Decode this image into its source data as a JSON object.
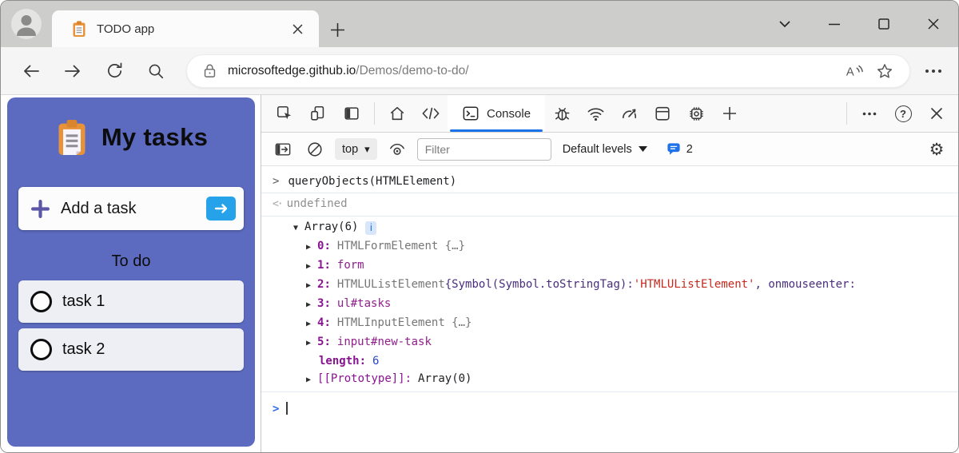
{
  "titlebar": {
    "tab_title": "TODO app"
  },
  "toolbar": {
    "url_host": "microsoftedge.github.io",
    "url_path": "/Demos/demo-to-do/"
  },
  "app": {
    "title": "My tasks",
    "add_task_label": "Add a task",
    "section_title": "To do",
    "tasks": [
      "task 1",
      "task 2"
    ]
  },
  "devtools": {
    "tabbar": {
      "console_tab_label": "Console"
    },
    "filterbar": {
      "context_label": "top",
      "filter_placeholder": "Filter",
      "levels_label": "Default levels",
      "message_count": "2"
    },
    "console": {
      "input_command": "queryObjects(HTMLElement)",
      "result_value": "undefined",
      "array": {
        "header": "Array(6)",
        "info_badge": "i",
        "items": [
          {
            "key": "0:",
            "preview": "HTMLFormElement {…}"
          },
          {
            "key": "1:",
            "node": "form"
          },
          {
            "key": "2:",
            "class_name": "HTMLUListElement ",
            "preview_dark": "{Symbol(Symbol.toStringTag): ",
            "string": "'HTMLUListElement'",
            "preview_dark_2": ", onmouseenter:"
          },
          {
            "key": "3:",
            "node": "ul#tasks"
          },
          {
            "key": "4:",
            "preview": "HTMLInputElement {…}"
          },
          {
            "key": "5:",
            "node": "input#new-task"
          }
        ],
        "length_key": "length:",
        "length_value": "6",
        "prototype_key": "[[Prototype]]:",
        "prototype_value": "Array(0)"
      }
    }
  },
  "colors": {
    "sidebar_purple": "#5c6bc0",
    "devtools_accent_blue": "#1a73e8",
    "add_submit_blue": "#25a2ea",
    "console_string_red": "#c5281c",
    "console_property_purple": "#881391",
    "console_number_blue": "#2745cc",
    "titlebar_gray": "#cdcdcb",
    "clipboard_orange": "#e8923a"
  }
}
